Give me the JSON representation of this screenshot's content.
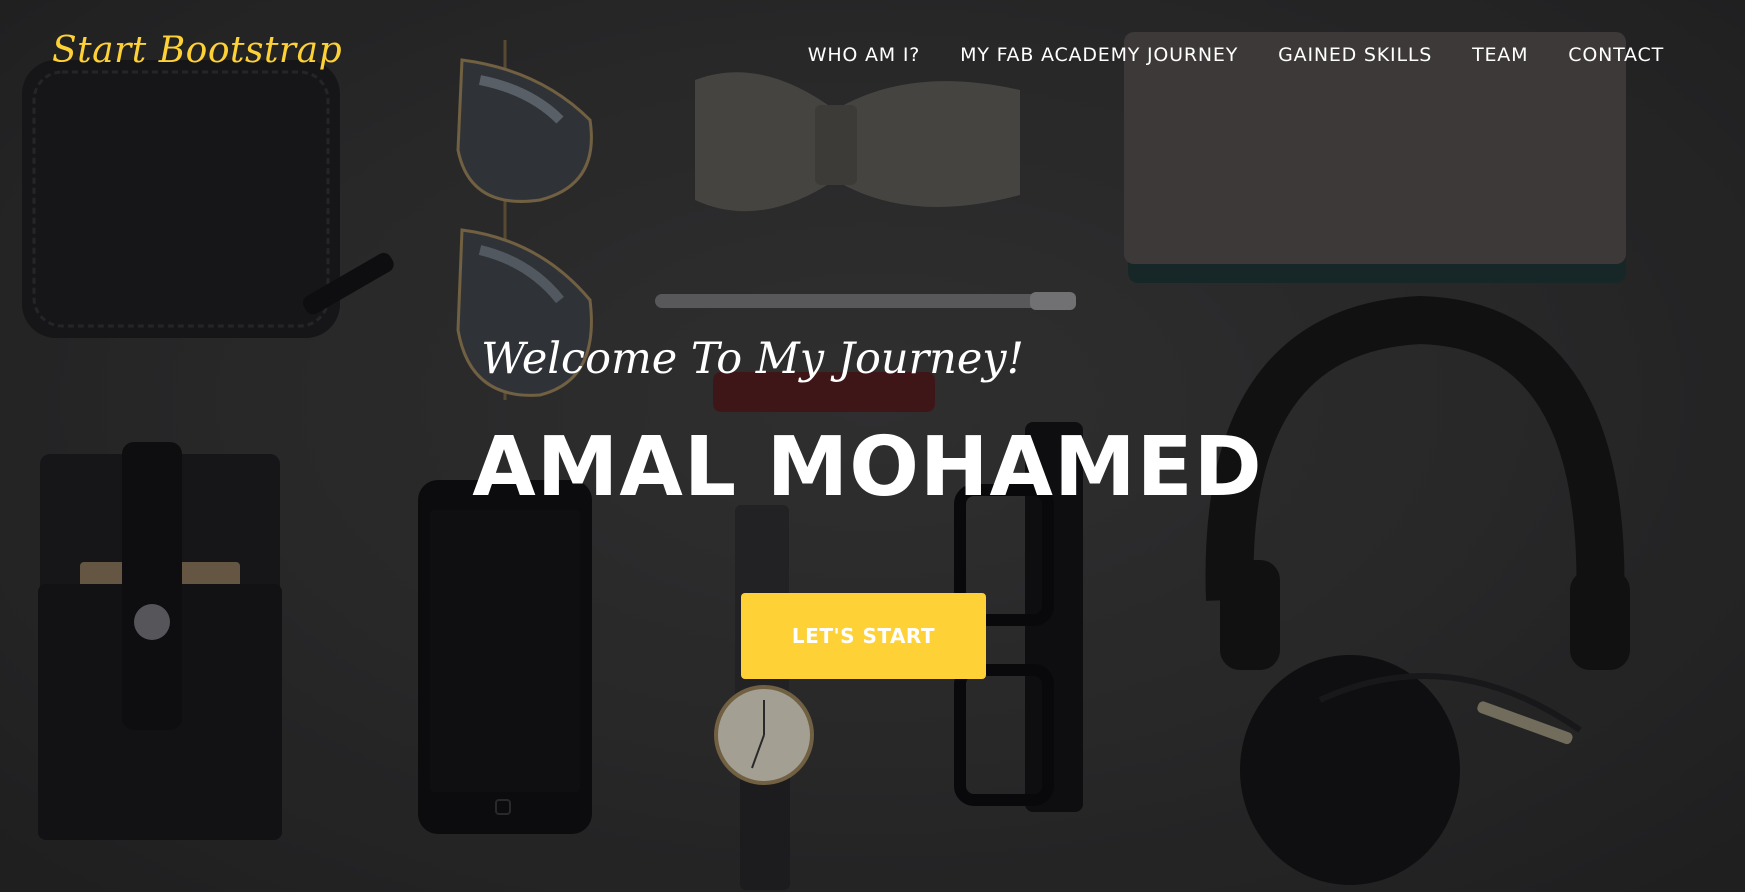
{
  "navbar": {
    "brand": "Start Bootstrap",
    "links": [
      {
        "label": "WHO AM I?"
      },
      {
        "label": "MY FAB ACADEMY JOURNEY"
      },
      {
        "label": "GAINED SKILLS"
      },
      {
        "label": "TEAM"
      },
      {
        "label": "CONTACT"
      }
    ]
  },
  "masthead": {
    "subheading": "Welcome To My Journey!",
    "heading": "AMAL MOHAMED",
    "cta_label": "LET'S START"
  },
  "colors": {
    "accent": "#fed136",
    "text": "#ffffff",
    "background": "#2f2f30"
  },
  "background_image": {
    "objects": [
      "wallet-icon",
      "sunglasses-icon",
      "bowtie-icon",
      "notebook-icon",
      "pen-icon",
      "lipbalm-icon",
      "phone-sleeve-icon",
      "smartphone-icon",
      "wristwatch-icon",
      "eyeglasses-icon",
      "headphones-icon"
    ]
  }
}
